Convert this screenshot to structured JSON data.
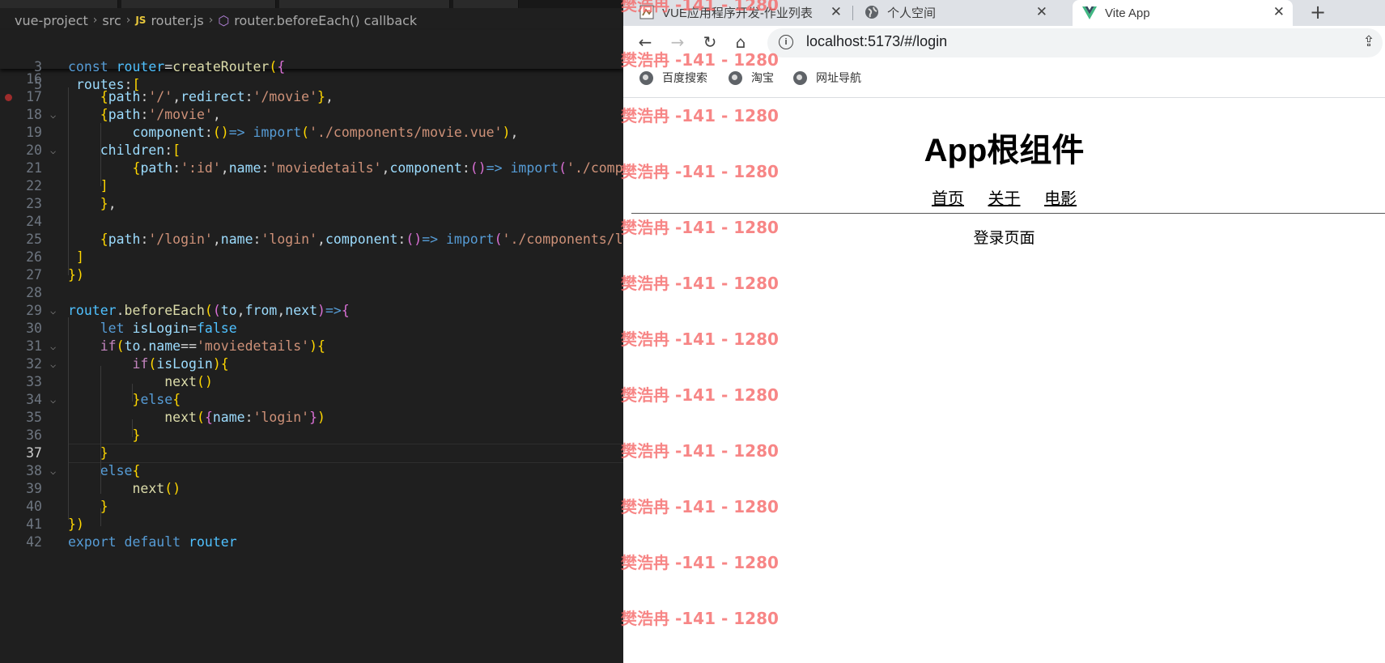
{
  "editor": {
    "breadcrumb": [
      "vue-project",
      "src",
      "router.js",
      "router.beforeEach() callback"
    ],
    "current_line": "37",
    "lines": [
      {
        "n": "3",
        "code": "const router=createRouter({"
      },
      {
        "n": "5",
        "code": " routes:["
      },
      {
        "n": "16",
        "code": ""
      },
      {
        "n": "17",
        "code": "    {path:'/',redirect:'/movie'},"
      },
      {
        "n": "18",
        "code": "    {path:'/movie',"
      },
      {
        "n": "19",
        "code": "        component:()=> import('./components/movie.vue'),"
      },
      {
        "n": "20",
        "code": "    children:["
      },
      {
        "n": "21",
        "code": "        {path:':id',name:'moviedetails',component:()=> import('./compon"
      },
      {
        "n": "22",
        "code": "    ]"
      },
      {
        "n": "23",
        "code": "    },"
      },
      {
        "n": "24",
        "code": ""
      },
      {
        "n": "25",
        "code": "    {path:'/login',name:'login',component:()=> import('./components/log"
      },
      {
        "n": "26",
        "code": " ]"
      },
      {
        "n": "27",
        "code": "})"
      },
      {
        "n": "28",
        "code": ""
      },
      {
        "n": "29",
        "code": "router.beforeEach((to,from,next)=>{"
      },
      {
        "n": "30",
        "code": "    let isLogin=false"
      },
      {
        "n": "31",
        "code": "    if(to.name=='moviedetails'){"
      },
      {
        "n": "32",
        "code": "        if(isLogin){"
      },
      {
        "n": "33",
        "code": "            next()"
      },
      {
        "n": "34",
        "code": "        }else{"
      },
      {
        "n": "35",
        "code": "            next({name:'login'})"
      },
      {
        "n": "36",
        "code": "        }"
      },
      {
        "n": "37",
        "code": "    }"
      },
      {
        "n": "38",
        "code": "    else{"
      },
      {
        "n": "39",
        "code": "        next()"
      },
      {
        "n": "40",
        "code": "    }"
      },
      {
        "n": "41",
        "code": "})"
      },
      {
        "n": "42",
        "code": "export default router"
      }
    ]
  },
  "browser": {
    "tabs": [
      {
        "title": "VUE应用程序开发-作业列表",
        "icon": "document-icon"
      },
      {
        "title": "个人空间",
        "icon": "globe-icon"
      },
      {
        "title": "Vite App",
        "icon": "vue-logo-icon"
      }
    ],
    "new_tab": "+",
    "url": "localhost:5173/#/login",
    "bookmarks": [
      "百度搜索",
      "淘宝",
      "网址导航"
    ],
    "page": {
      "title": "App根组件",
      "nav": [
        "首页",
        "关于",
        "电影"
      ],
      "content": "登录页面"
    }
  },
  "watermark": "樊浩冉 -141 - 1280"
}
